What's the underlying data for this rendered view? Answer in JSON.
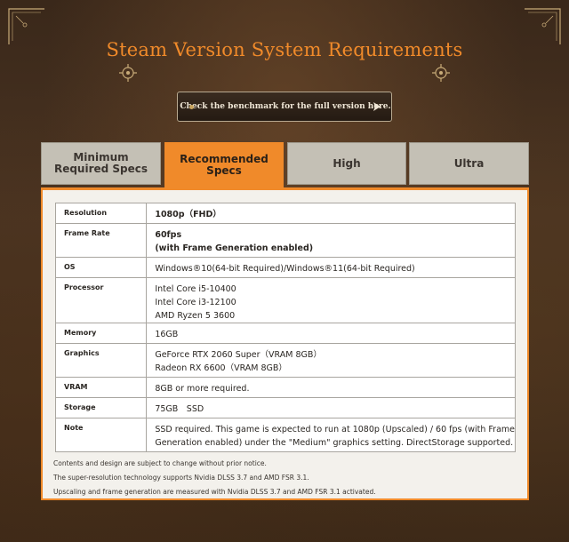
{
  "page": {
    "title": "Steam Version System Requirements",
    "benchmark_label": "Check the benchmark for the full version here."
  },
  "tabs": [
    {
      "label": "Minimum Required Specs",
      "active": false
    },
    {
      "label": "Recommended Specs",
      "active": true
    },
    {
      "label": "High",
      "active": false
    },
    {
      "label": "Ultra",
      "active": false
    }
  ],
  "specs": {
    "resolution": {
      "key": "Resolution",
      "value": "1080p（FHD）"
    },
    "frame_rate": {
      "key": "Frame Rate",
      "line1": "60fps",
      "line2": "(with Frame Generation enabled)"
    },
    "os": {
      "key": "OS",
      "value": "Windows®10(64-bit Required)/Windows®11(64-bit Required)"
    },
    "processor": {
      "key": "Processor",
      "line1": "Intel Core i5-10400",
      "line2": "Intel Core i3-12100",
      "line3": "AMD Ryzen 5 3600"
    },
    "memory": {
      "key": "Memory",
      "value": "16GB"
    },
    "graphics": {
      "key": "Graphics",
      "line1": "GeForce RTX 2060 Super（VRAM 8GB）",
      "line2": "Radeon RX 6600（VRAM 8GB）"
    },
    "vram": {
      "key": "VRAM",
      "value": "8GB or more required."
    },
    "storage": {
      "key": "Storage",
      "value": "75GB　SSD"
    },
    "note": {
      "key": "Note",
      "line1": "SSD required. This game is expected to run at 1080p (Upscaled) / 60 fps (with Frame",
      "line2": "Generation enabled) under the \"Medium\" graphics setting. DirectStorage supported."
    }
  },
  "notes": {
    "n1": "Contents and design are subject to change without prior notice.",
    "n2": "The super-resolution technology supports Nvidia DLSS 3.7 and AMD FSR 3.1.",
    "n3": "Upscaling and frame generation are measured with Nvidia DLSS 3.7 and AMD FSR 3.1 activated."
  },
  "colors": {
    "accent": "#f08a2a",
    "tab_inactive": "#c4c0b5",
    "panel": "#f3f1ec"
  }
}
